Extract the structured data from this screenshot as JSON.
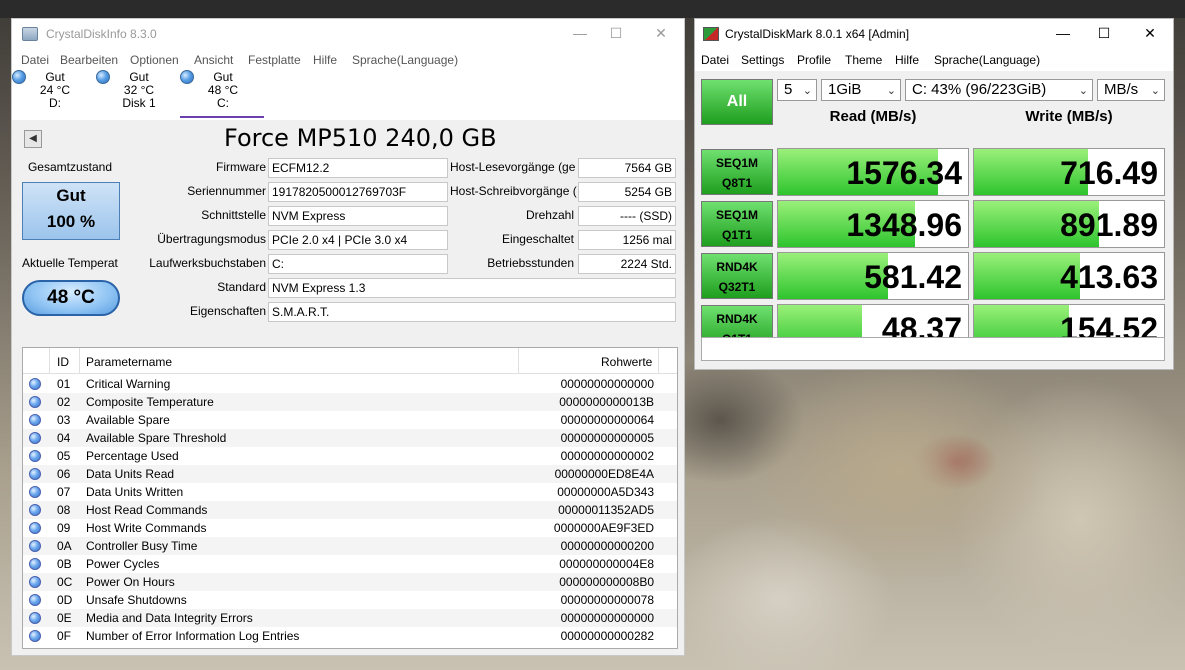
{
  "cdi": {
    "title": "CrystalDiskInfo 8.3.0",
    "menu": [
      "Datei",
      "Bearbeiten",
      "Optionen",
      "Ansicht",
      "Festplatte",
      "Hilfe",
      "Sprache(Language)"
    ],
    "drives": [
      {
        "status": "Gut",
        "temp": "24 °C",
        "name": "D:"
      },
      {
        "status": "Gut",
        "temp": "32 °C",
        "name": "Disk 1"
      },
      {
        "status": "Gut",
        "temp": "48 °C",
        "name": "C:"
      }
    ],
    "model": "Force MP510 240,0 GB",
    "health_label": "Gesamtzustand",
    "health_status": "Gut",
    "health_percent": "100 %",
    "temp_label": "Aktuelle Temperat",
    "temp_value": "48 °C",
    "fields": {
      "firmware_label": "Firmware",
      "firmware": "ECFM12.2",
      "serial_label": "Seriennummer",
      "serial": "1917820500012769703F",
      "interface_label": "Schnittstelle",
      "interface": "NVM Express",
      "transfer_label": "Übertragungsmodus",
      "transfer": "PCIe 2.0 x4 | PCIe 3.0 x4",
      "drive_letter_label": "Laufwerksbuchstaben",
      "drive_letter": "C:",
      "standard_label": "Standard",
      "standard": "NVM Express 1.3",
      "features_label": "Eigenschaften",
      "features": "S.M.A.R.T.",
      "host_reads_label": "Host-Lesevorgänge (ge",
      "host_reads": "7564 GB",
      "host_writes_label": "Host-Schreibvorgänge (",
      "host_writes": "5254 GB",
      "rotation_label": "Drehzahl",
      "rotation": "---- (SSD)",
      "power_count_label": "Eingeschaltet",
      "power_count": "1256 mal",
      "power_hours_label": "Betriebsstunden",
      "power_hours": "2224 Std."
    },
    "smart_headers": {
      "id": "ID",
      "name": "Parametername",
      "raw": "Rohwerte"
    },
    "smart_rows": [
      {
        "id": "01",
        "name": "Critical Warning",
        "raw": "00000000000000"
      },
      {
        "id": "02",
        "name": "Composite Temperature",
        "raw": "0000000000013B"
      },
      {
        "id": "03",
        "name": "Available Spare",
        "raw": "00000000000064"
      },
      {
        "id": "04",
        "name": "Available Spare Threshold",
        "raw": "00000000000005"
      },
      {
        "id": "05",
        "name": "Percentage Used",
        "raw": "00000000000002"
      },
      {
        "id": "06",
        "name": "Data Units Read",
        "raw": "00000000ED8E4A"
      },
      {
        "id": "07",
        "name": "Data Units Written",
        "raw": "00000000A5D343"
      },
      {
        "id": "08",
        "name": "Host Read Commands",
        "raw": "00000011352AD5"
      },
      {
        "id": "09",
        "name": "Host Write Commands",
        "raw": "0000000AE9F3ED"
      },
      {
        "id": "0A",
        "name": "Controller Busy Time",
        "raw": "00000000000200"
      },
      {
        "id": "0B",
        "name": "Power Cycles",
        "raw": "000000000004E8"
      },
      {
        "id": "0C",
        "name": "Power On Hours",
        "raw": "000000000008B0"
      },
      {
        "id": "0D",
        "name": "Unsafe Shutdowns",
        "raw": "00000000000078"
      },
      {
        "id": "0E",
        "name": "Media and Data Integrity Errors",
        "raw": "00000000000000"
      },
      {
        "id": "0F",
        "name": "Number of Error Information Log Entries",
        "raw": "00000000000282"
      }
    ]
  },
  "cdm": {
    "title": "CrystalDiskMark 8.0.1 x64 [Admin]",
    "menu": [
      "Datei",
      "Settings",
      "Profile",
      "Theme",
      "Hilfe",
      "Sprache(Language)"
    ],
    "all_label": "All",
    "count": "5",
    "size": "1GiB",
    "drive": "C: 43% (96/223GiB)",
    "unit": "MB/s",
    "read_header": "Read (MB/s)",
    "write_header": "Write (MB/s)",
    "tests": [
      {
        "line1": "SEQ1M",
        "line2": "Q8T1",
        "read": "1576.34",
        "write": "716.49",
        "read_fill": 0.84,
        "write_fill": 0.6
      },
      {
        "line1": "SEQ1M",
        "line2": "Q1T1",
        "read": "1348.96",
        "write": "891.89",
        "read_fill": 0.72,
        "write_fill": 0.66
      },
      {
        "line1": "RND4K",
        "line2": "Q32T1",
        "read": "581.42",
        "write": "413.63",
        "read_fill": 0.58,
        "write_fill": 0.56
      },
      {
        "line1": "RND4K",
        "line2": "Q1T1",
        "read": "48.37",
        "write": "154.52",
        "read_fill": 0.44,
        "write_fill": 0.5
      }
    ]
  }
}
